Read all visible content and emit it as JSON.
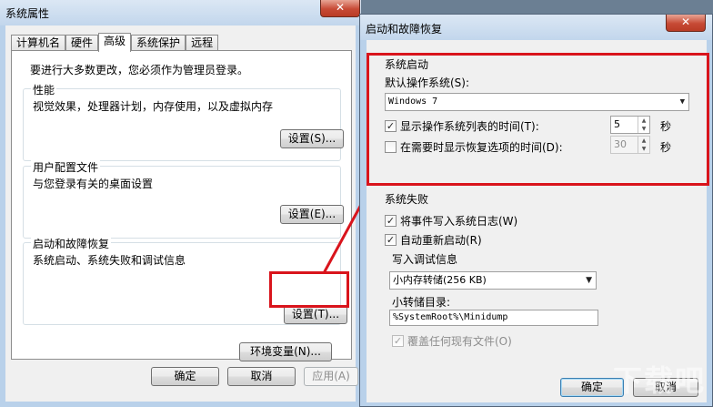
{
  "back_window": {
    "title": "系统属性",
    "close": "✕",
    "tabs": [
      "计算机名",
      "硬件",
      "高级",
      "系统保护",
      "远程"
    ],
    "intro": "要进行大多数更改，您必须作为管理员登录。",
    "performance": {
      "legend": "性能",
      "desc": "视觉效果，处理器计划，内存使用，以及虚拟内存",
      "button": "设置(S)..."
    },
    "profiles": {
      "legend": "用户配置文件",
      "desc": "与您登录有关的桌面设置",
      "button": "设置(E)..."
    },
    "startup": {
      "legend": "启动和故障恢复",
      "desc": "系统启动、系统失败和调试信息",
      "button": "设置(T)..."
    },
    "env_button": "环境变量(N)...",
    "ok": "确定",
    "cancel": "取消",
    "apply": "应用(A)"
  },
  "front_window": {
    "title": "启动和故障恢复",
    "close": "✕",
    "system_startup": {
      "legend": "系统启动",
      "default_os_label": "默认操作系统(S):",
      "default_os_value": "Windows 7",
      "show_list_label": "显示操作系统列表的时间(T):",
      "show_list_checked": "✓",
      "show_list_value": "5",
      "show_recovery_label": "在需要时显示恢复选项的时间(D):",
      "show_recovery_value": "30",
      "seconds": "秒"
    },
    "system_failure": {
      "legend": "系统失败",
      "write_log_label": "将事件写入系统日志(W)",
      "auto_restart_label": "自动重新启动(R)",
      "checked": "✓",
      "debug_legend": "写入调试信息",
      "debug_value": "小内存转储(256 KB)",
      "dump_dir_label": "小转储目录:",
      "dump_dir_value": "%SystemRoot%\\Minidump",
      "overwrite_label": "覆盖任何现有文件(O)"
    },
    "ok": "确定",
    "cancel": "取消"
  },
  "watermark": "下载吧",
  "colors": {
    "highlight": "#d9141c",
    "desktop": "#6b7f93",
    "chrome": "#b9d1ea"
  }
}
